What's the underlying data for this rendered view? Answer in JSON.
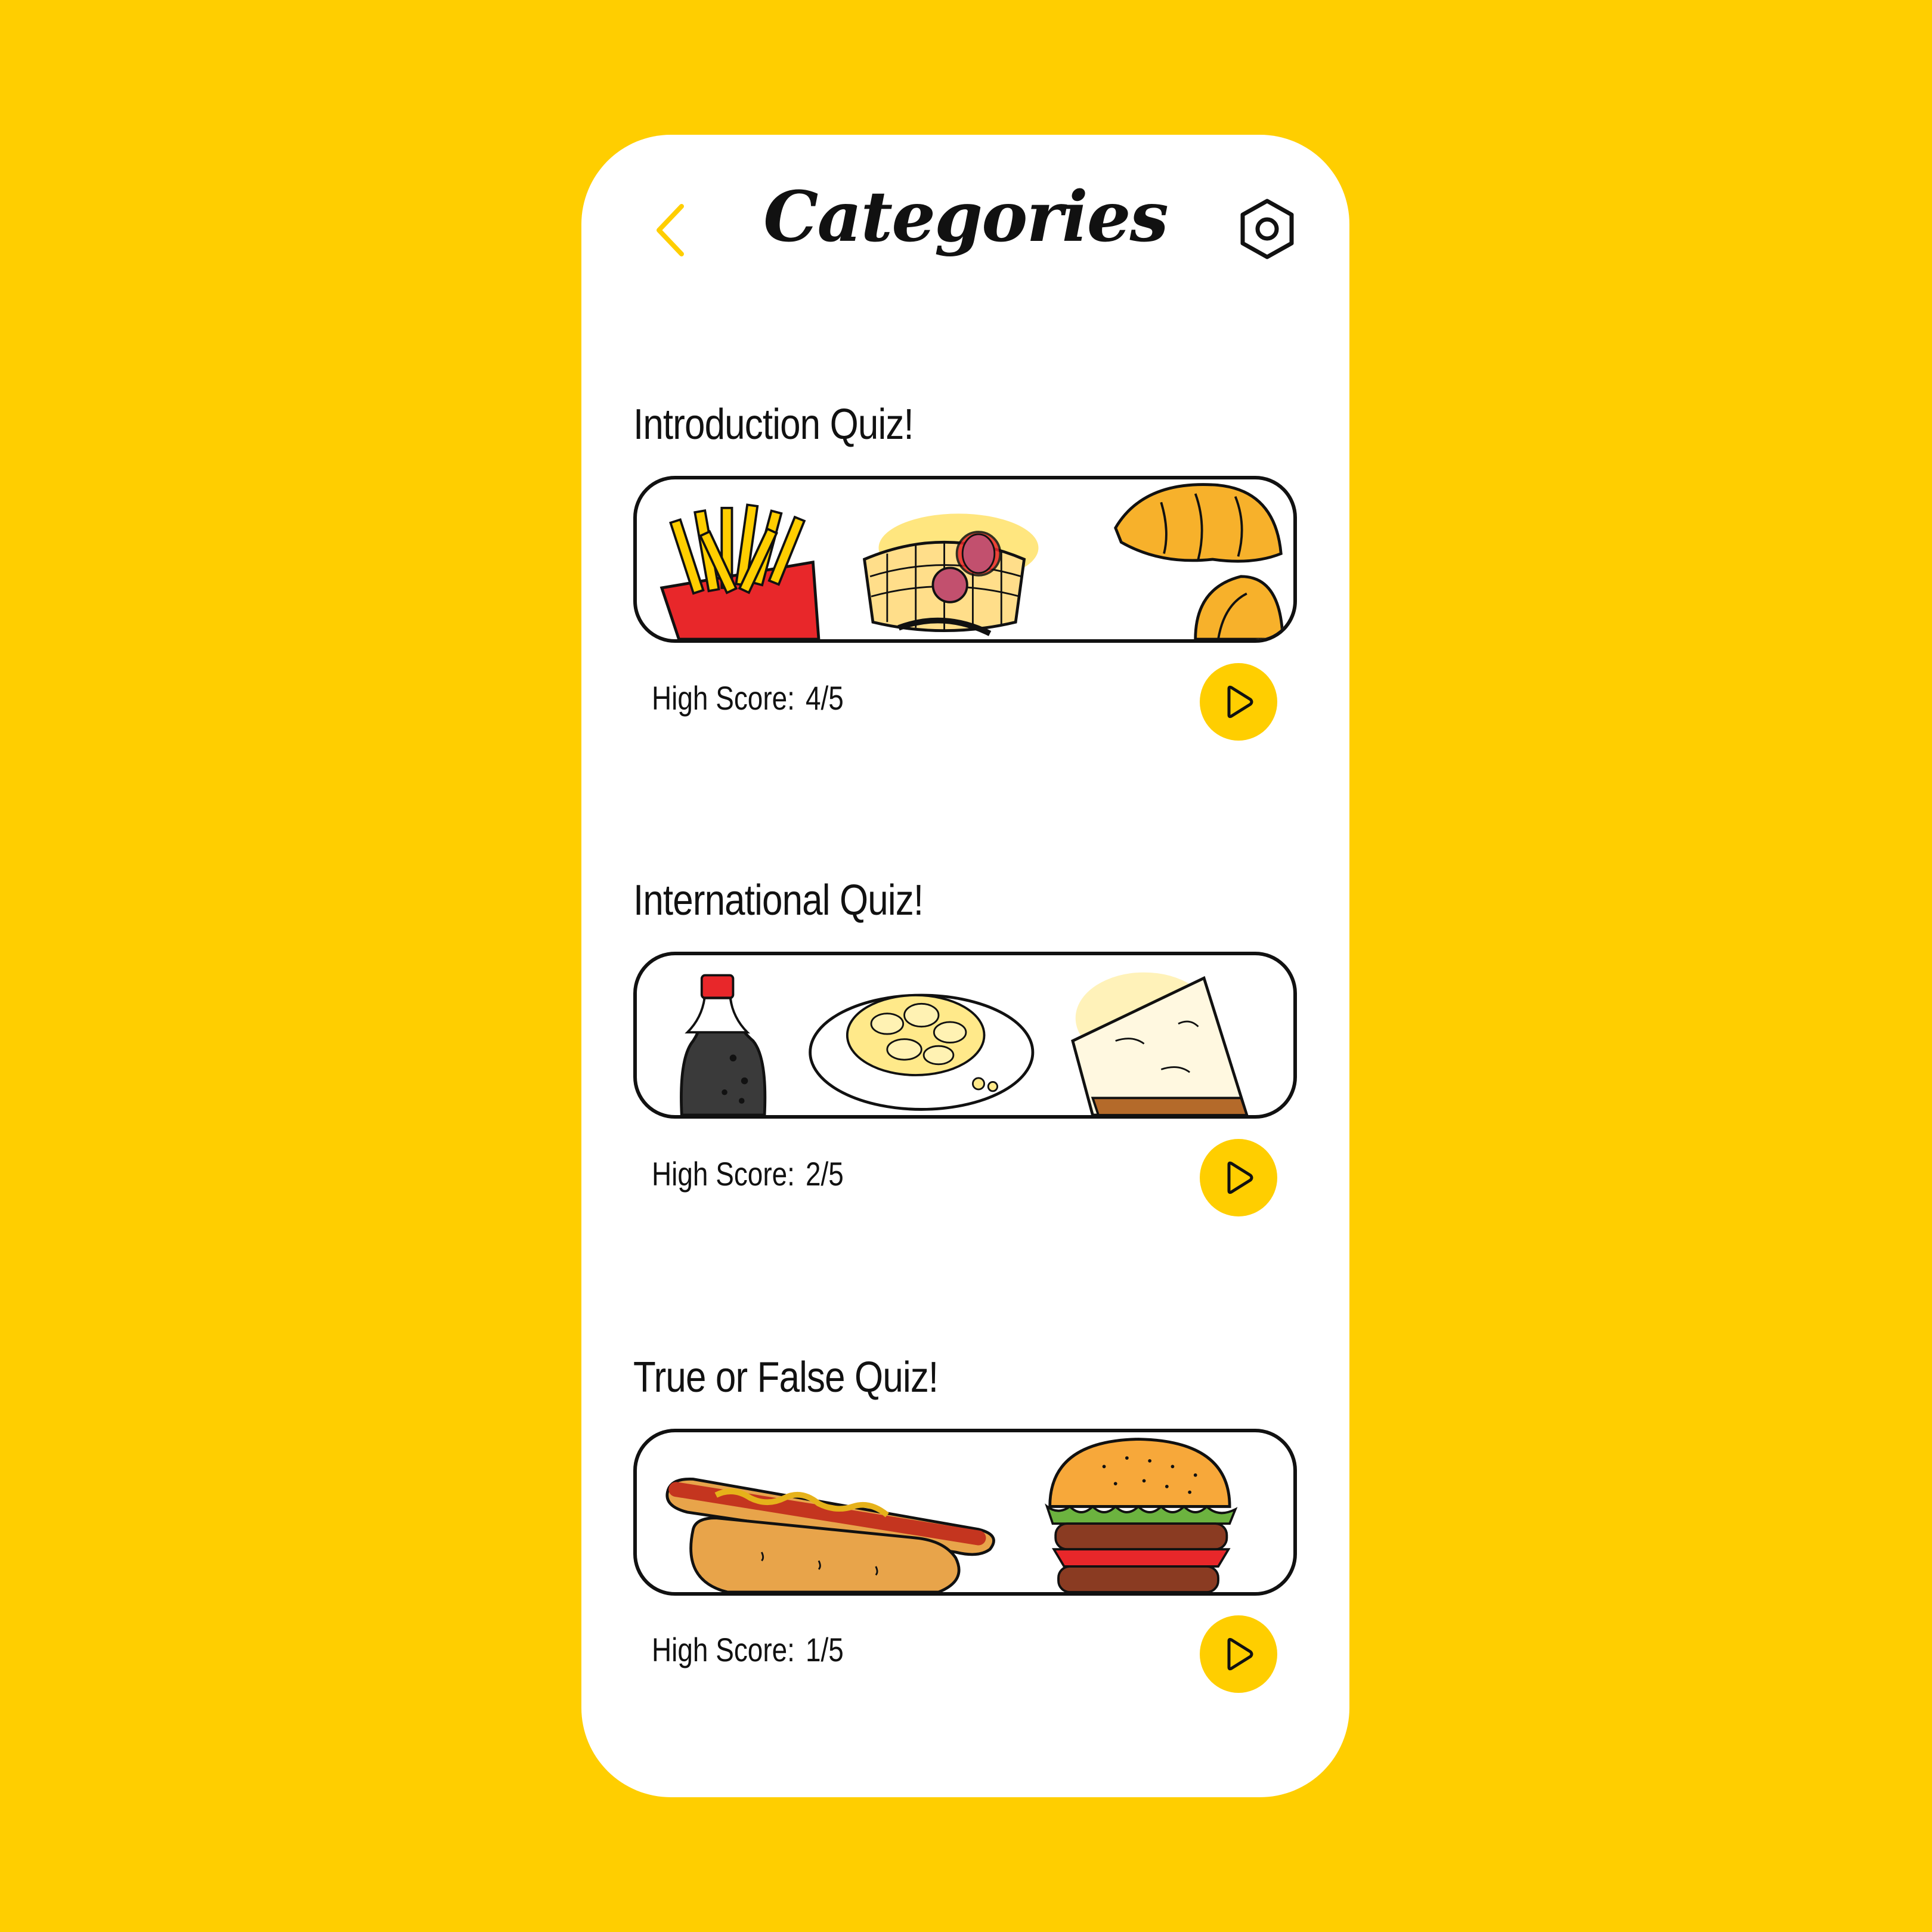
{
  "header": {
    "title": "Categories",
    "back_icon": "chevron-left-icon",
    "settings_icon": "hexagon-settings-icon"
  },
  "colors": {
    "background": "#FFCE00",
    "card": "#FFFFFF",
    "accent": "#FFCE00",
    "text": "#111111"
  },
  "categories": [
    {
      "title": "Introduction Quiz!",
      "score_label": "High Score:",
      "score_value": "4/5",
      "illustrations": [
        "fries",
        "waffles",
        "croissant"
      ],
      "play_icon": "play-icon"
    },
    {
      "title": "International Quiz!",
      "score_label": "High Score:",
      "score_value": "2/5",
      "illustrations": [
        "soda-bottle",
        "pasta-plate",
        "cheesecake"
      ],
      "play_icon": "play-icon"
    },
    {
      "title": "True or False Quiz!",
      "score_label": "High Score:",
      "score_value": "1/5",
      "illustrations": [
        "hotdog",
        "burger"
      ],
      "play_icon": "play-icon"
    }
  ]
}
